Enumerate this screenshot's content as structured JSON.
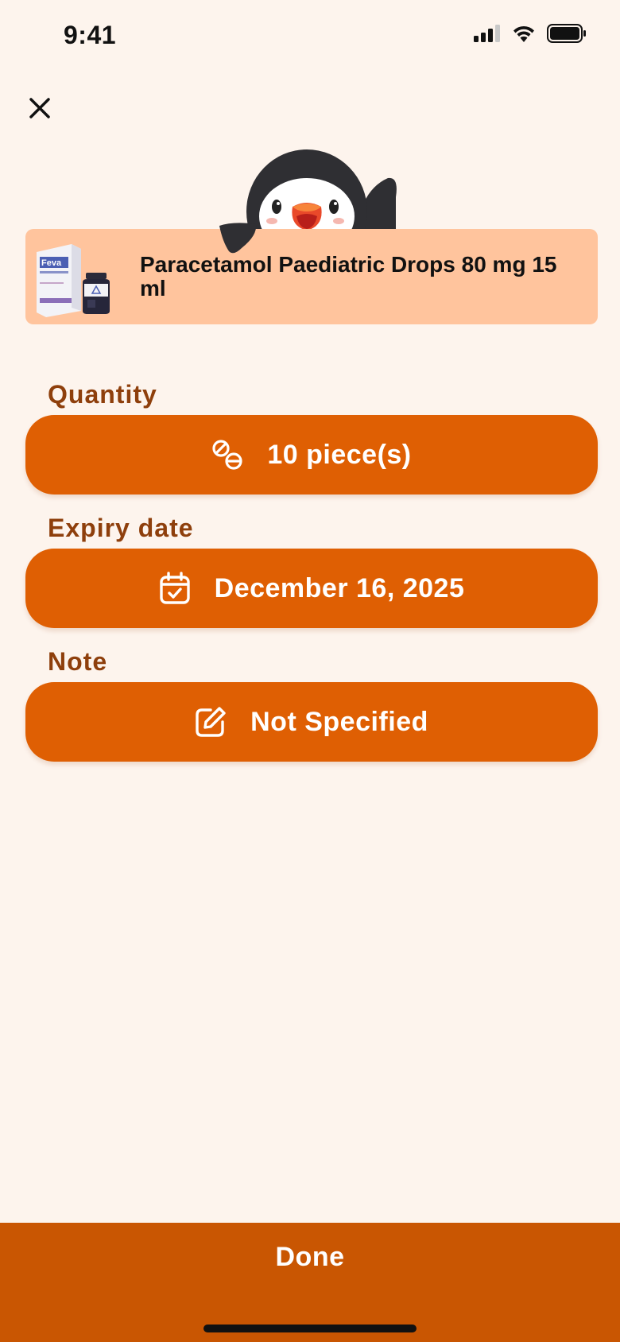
{
  "status_bar": {
    "time": "9:41",
    "icons": [
      "cellular-signal-icon",
      "wifi-icon",
      "battery-icon"
    ]
  },
  "header": {
    "close_icon": "close-icon"
  },
  "mascot": {
    "icon": "penguin-mascot"
  },
  "product": {
    "name": "Paracetamol Paediatric Drops 80 mg 15 ml",
    "thumbnail_brand_text": "Feva"
  },
  "fields": {
    "quantity": {
      "label": "Quantity",
      "value": "10 piece(s)",
      "icon": "pills-icon"
    },
    "expiry": {
      "label": "Expiry date",
      "value": "December 16, 2025",
      "icon": "calendar-check-icon"
    },
    "note": {
      "label": "Note",
      "value": "Not Specified",
      "icon": "edit-note-icon"
    }
  },
  "footer": {
    "done_label": "Done"
  },
  "colors": {
    "background": "#fdf4ed",
    "accent": "#df5f03",
    "footer": "#c95602",
    "card": "#ffc49d",
    "label": "#8e3f0c"
  }
}
